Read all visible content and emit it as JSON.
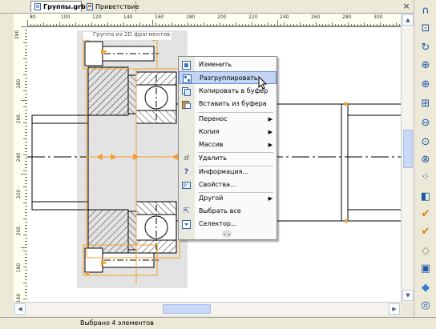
{
  "tabs": [
    {
      "label": "Группы.grb",
      "active": true
    },
    {
      "label": "Приветствие",
      "active": false
    }
  ],
  "hruler_ticks": [
    "80",
    "100",
    "120",
    "140",
    "160",
    "180",
    "200",
    "220",
    "240",
    "260",
    "280",
    "300"
  ],
  "vruler_ticks": [
    "280",
    "280",
    "260",
    "240",
    "220",
    "200",
    "180",
    "160"
  ],
  "group_label": "Группа из 2D фрагментов",
  "context_menu": {
    "items": [
      {
        "label": "Изменить",
        "icon": "edit-icon",
        "arrow": ""
      },
      {
        "label": "Разгруппировать",
        "icon": "ungroup-icon",
        "arrow": ""
      },
      {
        "label": "Копировать в буфер",
        "icon": "copy-icon",
        "arrow": ""
      },
      {
        "label": "Вставить из буфера",
        "icon": "paste-icon",
        "arrow": ""
      },
      {
        "label": "Перенос",
        "icon": "",
        "arrow": "▶"
      },
      {
        "label": "Копия",
        "icon": "",
        "arrow": "▶"
      },
      {
        "label": "Массив",
        "icon": "",
        "arrow": "▶"
      },
      {
        "label": "Удалить",
        "icon": "delete-icon",
        "arrow": ""
      },
      {
        "label": "Информация...",
        "icon": "info-icon",
        "arrow": ""
      },
      {
        "label": "Свойства...",
        "icon": "properties-icon",
        "arrow": ""
      },
      {
        "label": "Другой",
        "icon": "",
        "arrow": "▶"
      },
      {
        "label": "Выбрать все",
        "icon": "select-all-icon",
        "arrow": ""
      },
      {
        "label": "Селектор...",
        "icon": "selector-icon",
        "arrow": ""
      }
    ],
    "more": "⌄⌄",
    "highlighted_index": 1
  },
  "status": {
    "text": "Выбрано 4 элементов"
  },
  "colors": {
    "selection": "#f0a030",
    "highlight": "#c4d4f4",
    "drawing": "#000000",
    "group_bg": "#e8e8e8"
  }
}
